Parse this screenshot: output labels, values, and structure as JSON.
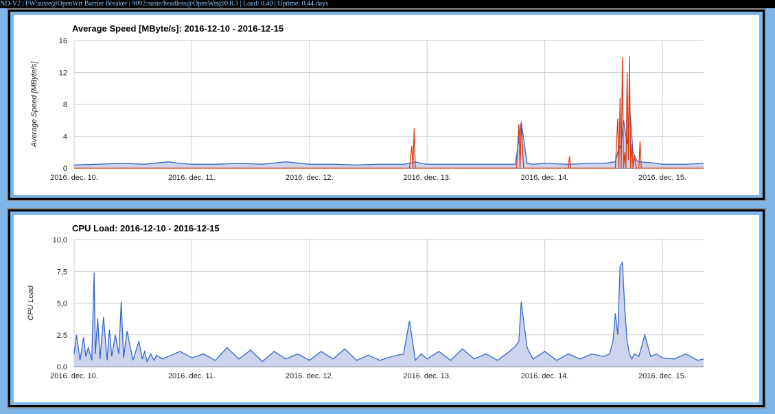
{
  "status_bar": "ND-V2 | FW:suste@OpenWrt Barrier Breaker | 9092:suste/headless@OpenWrt@0.8.3 | Load: 0.40 | Uptime: 0.44 days",
  "colors": {
    "blue": "#3366cc",
    "red": "#dc3912",
    "area": "#c6cdea"
  },
  "chart_data": [
    {
      "type": "line",
      "title": "Average Speed [MByte/s]: 2016-12-10 - 2016-12-15",
      "ylabel": "Average Speed [MByte/s]",
      "xlabel": "",
      "ylim": [
        0,
        16
      ],
      "yticks": [
        "0",
        "4",
        "8",
        "12",
        "16"
      ],
      "xticks": [
        "2016. dec. 10.",
        "2016. dec. 11.",
        "2016. dec. 12.",
        "2016. dec. 13.",
        "2016. dec. 14.",
        "2016. dec. 15."
      ],
      "grid": true,
      "series": [
        {
          "color": "#3366cc",
          "area": true,
          "x": [
            0,
            0.2,
            0.4,
            0.6,
            0.8,
            0.9,
            1.0,
            1.2,
            1.4,
            1.6,
            1.8,
            2.0,
            2.2,
            2.4,
            2.6,
            2.8,
            2.85,
            2.9,
            2.95,
            3.0,
            3.2,
            3.4,
            3.6,
            3.75,
            3.8,
            3.85,
            3.9,
            4.0,
            4.2,
            4.4,
            4.5,
            4.6,
            4.62,
            4.65,
            4.67,
            4.7,
            4.72,
            4.75,
            4.78,
            4.8,
            4.9,
            5.0,
            5.2,
            5.35
          ],
          "y": [
            0.4,
            0.5,
            0.6,
            0.5,
            0.8,
            0.6,
            0.5,
            0.5,
            0.6,
            0.5,
            0.8,
            0.5,
            0.5,
            0.4,
            0.5,
            0.5,
            0.6,
            0.8,
            0.6,
            0.5,
            0.5,
            0.5,
            0.5,
            0.5,
            5.8,
            0.6,
            0.5,
            0.6,
            0.5,
            0.6,
            0.6,
            0.8,
            2.0,
            3.0,
            6.0,
            3.0,
            8.0,
            2.0,
            1.0,
            0.8,
            0.7,
            0.5,
            0.5,
            0.6
          ]
        },
        {
          "color": "#dc3912",
          "area": false,
          "x": [
            0,
            2.85,
            2.87,
            2.88,
            2.89,
            2.9,
            2.92,
            3.76,
            3.78,
            3.79,
            3.8,
            3.82,
            4.2,
            4.21,
            4.22,
            4.6,
            4.62,
            4.63,
            4.64,
            4.65,
            4.66,
            4.67,
            4.68,
            4.69,
            4.7,
            4.71,
            4.72,
            4.73,
            4.74,
            4.75,
            4.76,
            4.78,
            4.8,
            4.81,
            4.82,
            4.83,
            5.35
          ],
          "y": [
            0,
            0,
            2.8,
            0,
            5.0,
            0,
            0,
            0,
            5.5,
            0,
            5.6,
            0,
            0,
            1.5,
            0,
            0,
            6.2,
            0,
            8.8,
            0,
            13.9,
            0,
            2.0,
            0,
            12.0,
            1.0,
            14.0,
            0,
            3.0,
            0,
            1.5,
            0,
            0,
            3.4,
            0,
            0,
            0
          ]
        }
      ]
    },
    {
      "type": "area",
      "title": "CPU Load: 2016-12-10 - 2016-12-15",
      "ylabel": "CPU Load",
      "xlabel": "",
      "ylim": [
        0,
        10
      ],
      "yticks": [
        "0,0",
        "2,5",
        "5,0",
        "7,5",
        "10,0"
      ],
      "xticks": [
        "2016. dec. 10.",
        "2016. dec. 11.",
        "2016. dec. 12.",
        "2016. dec. 13.",
        "2016. dec. 14.",
        "2016. dec. 15."
      ],
      "grid": true,
      "series": [
        {
          "color": "#3366cc",
          "area": true,
          "x": [
            0,
            0.02,
            0.05,
            0.08,
            0.1,
            0.12,
            0.15,
            0.17,
            0.18,
            0.2,
            0.22,
            0.25,
            0.28,
            0.3,
            0.32,
            0.35,
            0.38,
            0.4,
            0.42,
            0.45,
            0.5,
            0.55,
            0.58,
            0.6,
            0.62,
            0.65,
            0.68,
            0.7,
            0.75,
            0.8,
            0.9,
            1.0,
            1.1,
            1.2,
            1.3,
            1.4,
            1.5,
            1.6,
            1.7,
            1.8,
            1.9,
            2.0,
            2.1,
            2.2,
            2.3,
            2.4,
            2.5,
            2.6,
            2.7,
            2.8,
            2.85,
            2.9,
            2.95,
            3.0,
            3.1,
            3.2,
            3.3,
            3.4,
            3.5,
            3.6,
            3.7,
            3.75,
            3.78,
            3.8,
            3.85,
            3.9,
            4.0,
            4.1,
            4.2,
            4.3,
            4.4,
            4.5,
            4.55,
            4.58,
            4.6,
            4.62,
            4.64,
            4.66,
            4.68,
            4.7,
            4.72,
            4.74,
            4.76,
            4.8,
            4.85,
            4.9,
            4.95,
            5.0,
            5.1,
            5.2,
            5.3,
            5.35
          ],
          "y": [
            1.0,
            2.5,
            0.5,
            2.3,
            0.8,
            1.5,
            0.5,
            7.4,
            1.0,
            3.8,
            0.6,
            3.9,
            0.5,
            2.9,
            0.8,
            2.5,
            1.0,
            5.1,
            0.7,
            2.8,
            0.5,
            2.0,
            0.6,
            1.2,
            0.4,
            1.0,
            0.5,
            0.9,
            0.6,
            0.8,
            1.2,
            0.7,
            1.0,
            0.5,
            1.5,
            0.6,
            1.3,
            0.4,
            1.2,
            0.6,
            1.0,
            0.5,
            1.2,
            0.6,
            1.4,
            0.5,
            0.9,
            0.5,
            0.8,
            1.0,
            3.6,
            0.5,
            1.0,
            0.6,
            1.2,
            0.5,
            1.4,
            0.6,
            1.0,
            0.5,
            1.2,
            1.6,
            2.0,
            5.1,
            1.5,
            0.6,
            1.2,
            0.5,
            1.0,
            0.6,
            1.0,
            0.8,
            1.0,
            2.0,
            4.2,
            2.5,
            7.9,
            8.2,
            4.5,
            2.0,
            1.0,
            0.6,
            1.0,
            0.8,
            2.5,
            0.8,
            1.0,
            0.7,
            0.6,
            1.0,
            0.5,
            0.6
          ]
        }
      ]
    }
  ]
}
